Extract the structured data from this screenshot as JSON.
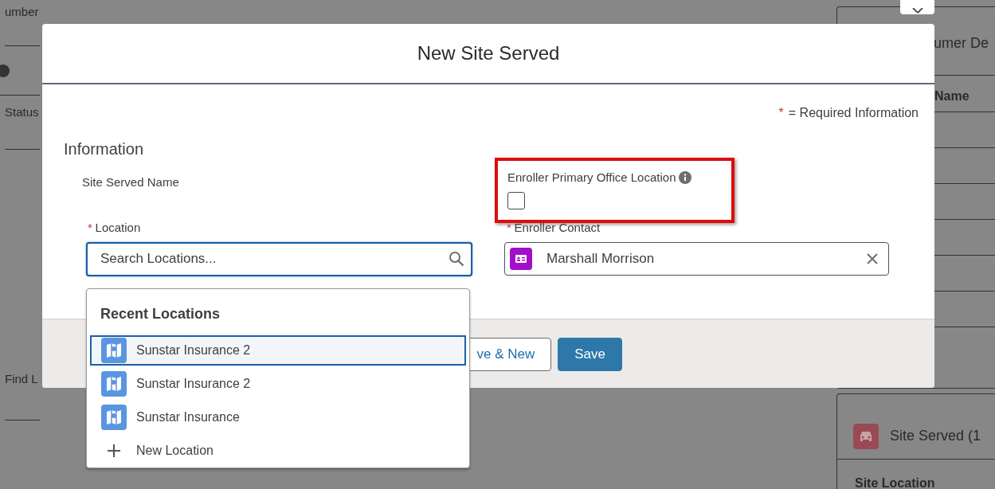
{
  "background": {
    "left_labels": [
      "umber",
      "Status",
      "Find L"
    ],
    "panel": {
      "title": "umer De",
      "column": "Name"
    },
    "related": {
      "title": "Site Served (1",
      "column": "Site Location"
    }
  },
  "modal": {
    "title": "New Site Served",
    "required_mark": "*",
    "required_note": "= Required Information",
    "section": "Information",
    "fields": [
      {
        "kind": "text",
        "label": "Site Served Name",
        "required": false
      },
      {
        "kind": "checkbox",
        "label": "Enroller Primary Office Location",
        "required": false,
        "checked": false,
        "highlighted": true,
        "info": true
      },
      {
        "kind": "lookup",
        "label": "Location",
        "required": true,
        "placeholder": "Search Locations...",
        "focused": true
      },
      {
        "kind": "lookup",
        "label": "Enroller Contact",
        "required": true,
        "value": "Marshall Morrison",
        "focused": false
      }
    ],
    "buttons": [
      {
        "label": "ve & New",
        "kind": "neutral"
      },
      {
        "label": "Save",
        "kind": "brand"
      }
    ],
    "dropdown": {
      "heading": "Recent Locations",
      "items": [
        {
          "label": "Sunstar Insurance 2",
          "kind": "record",
          "selected": true
        },
        {
          "label": "Sunstar Insurance 2",
          "kind": "record",
          "selected": false
        },
        {
          "label": "Sunstar Insurance",
          "kind": "record",
          "selected": false
        },
        {
          "label": "New Location",
          "kind": "action",
          "selected": false
        }
      ]
    }
  }
}
